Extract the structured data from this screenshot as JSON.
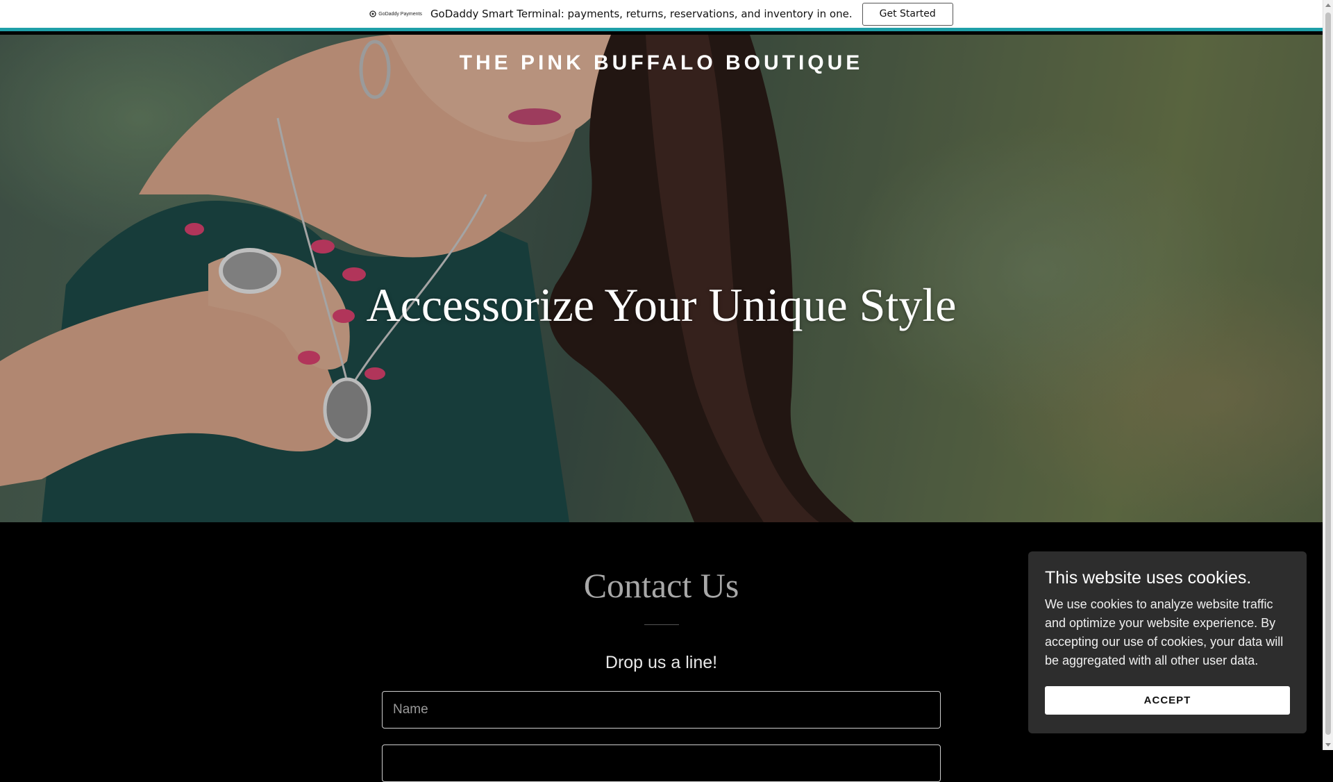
{
  "promo_bar": {
    "logo_text": "GoDaddy Payments",
    "message": "GoDaddy Smart Terminal: payments, returns, reservations, and inventory in one.",
    "cta_label": "Get Started",
    "accent_color": "#1f9fa8"
  },
  "header": {
    "site_title": "THE PINK BUFFALO BOUTIQUE"
  },
  "hero": {
    "heading": "Accessorize Your Unique Style"
  },
  "contact": {
    "title": "Contact Us",
    "subtitle": "Drop us a line!",
    "name_placeholder": "Name",
    "email_placeholder": ""
  },
  "cookie_banner": {
    "title": "This website uses cookies.",
    "body": "We use cookies to analyze website traffic and optimize your website experience. By accepting our use of cookies, your data will be aggregated with all other user data.",
    "accept_label": "ACCEPT"
  }
}
